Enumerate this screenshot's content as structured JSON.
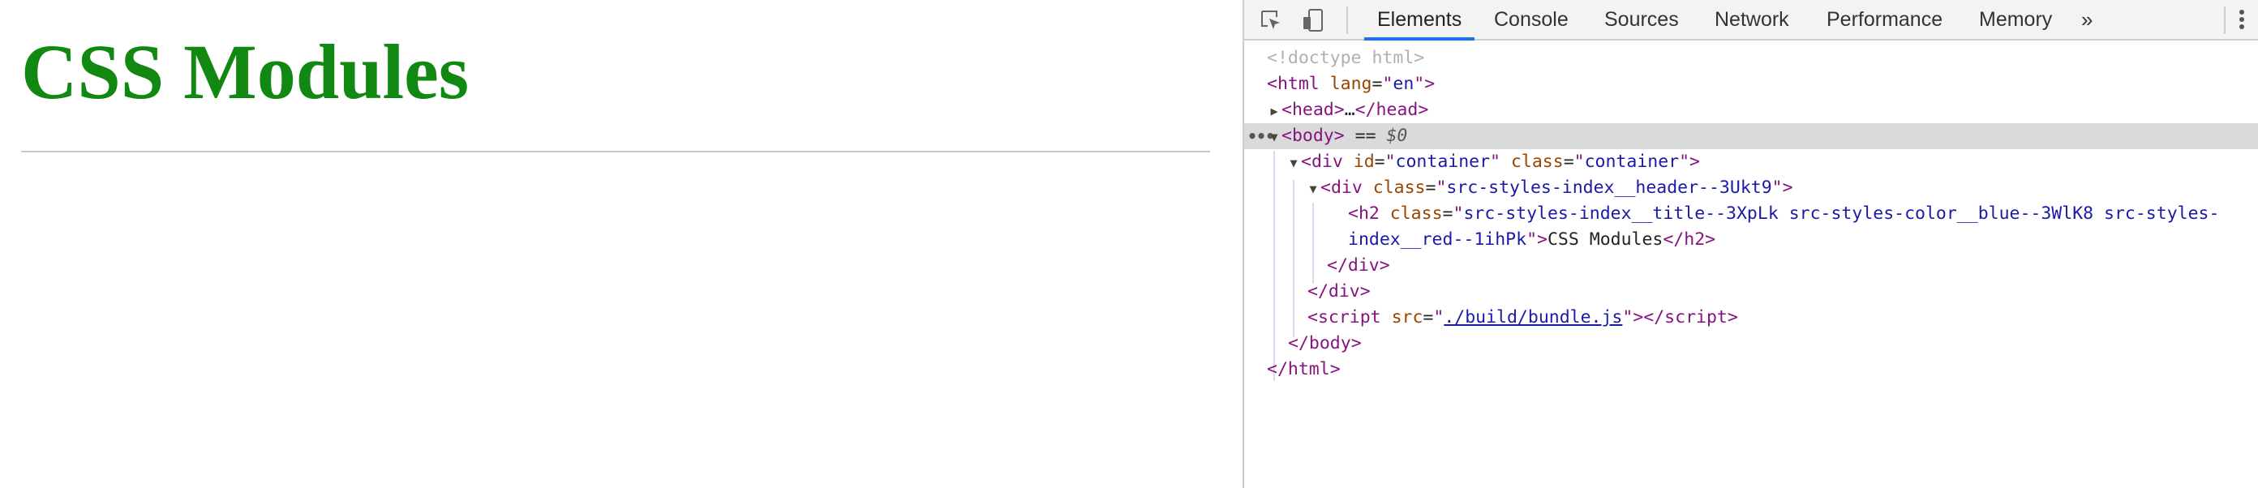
{
  "page": {
    "title": "CSS Modules"
  },
  "devtools": {
    "tabs": [
      "Elements",
      "Console",
      "Sources",
      "Network",
      "Performance",
      "Memory"
    ],
    "active_tab": "Elements",
    "more_tabs": "»",
    "tree": {
      "doctype": "<!doctype html>",
      "html_open": {
        "tag": "html",
        "attr": "lang",
        "value": "en"
      },
      "head": {
        "open": "head",
        "ellipsis": "…",
        "close": "/head"
      },
      "body": {
        "tag": "body",
        "marker": " == ",
        "var": "$0"
      },
      "div_container": {
        "tag": "div",
        "attr1": "id",
        "val1": "container",
        "attr2": "class",
        "val2": "container"
      },
      "div_header": {
        "tag": "div",
        "attr": "class",
        "value": "src-styles-index__header--3Ukt9"
      },
      "h2": {
        "tag": "h2",
        "attr": "class",
        "value_line1": "src-styles-index__title--3XpLk src-styles-color__blue--3WlK8 src-styles-",
        "value_line2": "index__red--1ihPk",
        "text": "CSS Modules",
        "close": "/h2"
      },
      "div_close": "/div",
      "script": {
        "tag": "script",
        "attr": "src",
        "value": "./build/bundle.js",
        "close": "/script"
      },
      "body_close": "/body",
      "html_close": "/html"
    }
  },
  "icons": {
    "inspect": "inspect-element-icon",
    "device": "device-toolbar-icon",
    "menu": "kebab-menu-icon"
  }
}
